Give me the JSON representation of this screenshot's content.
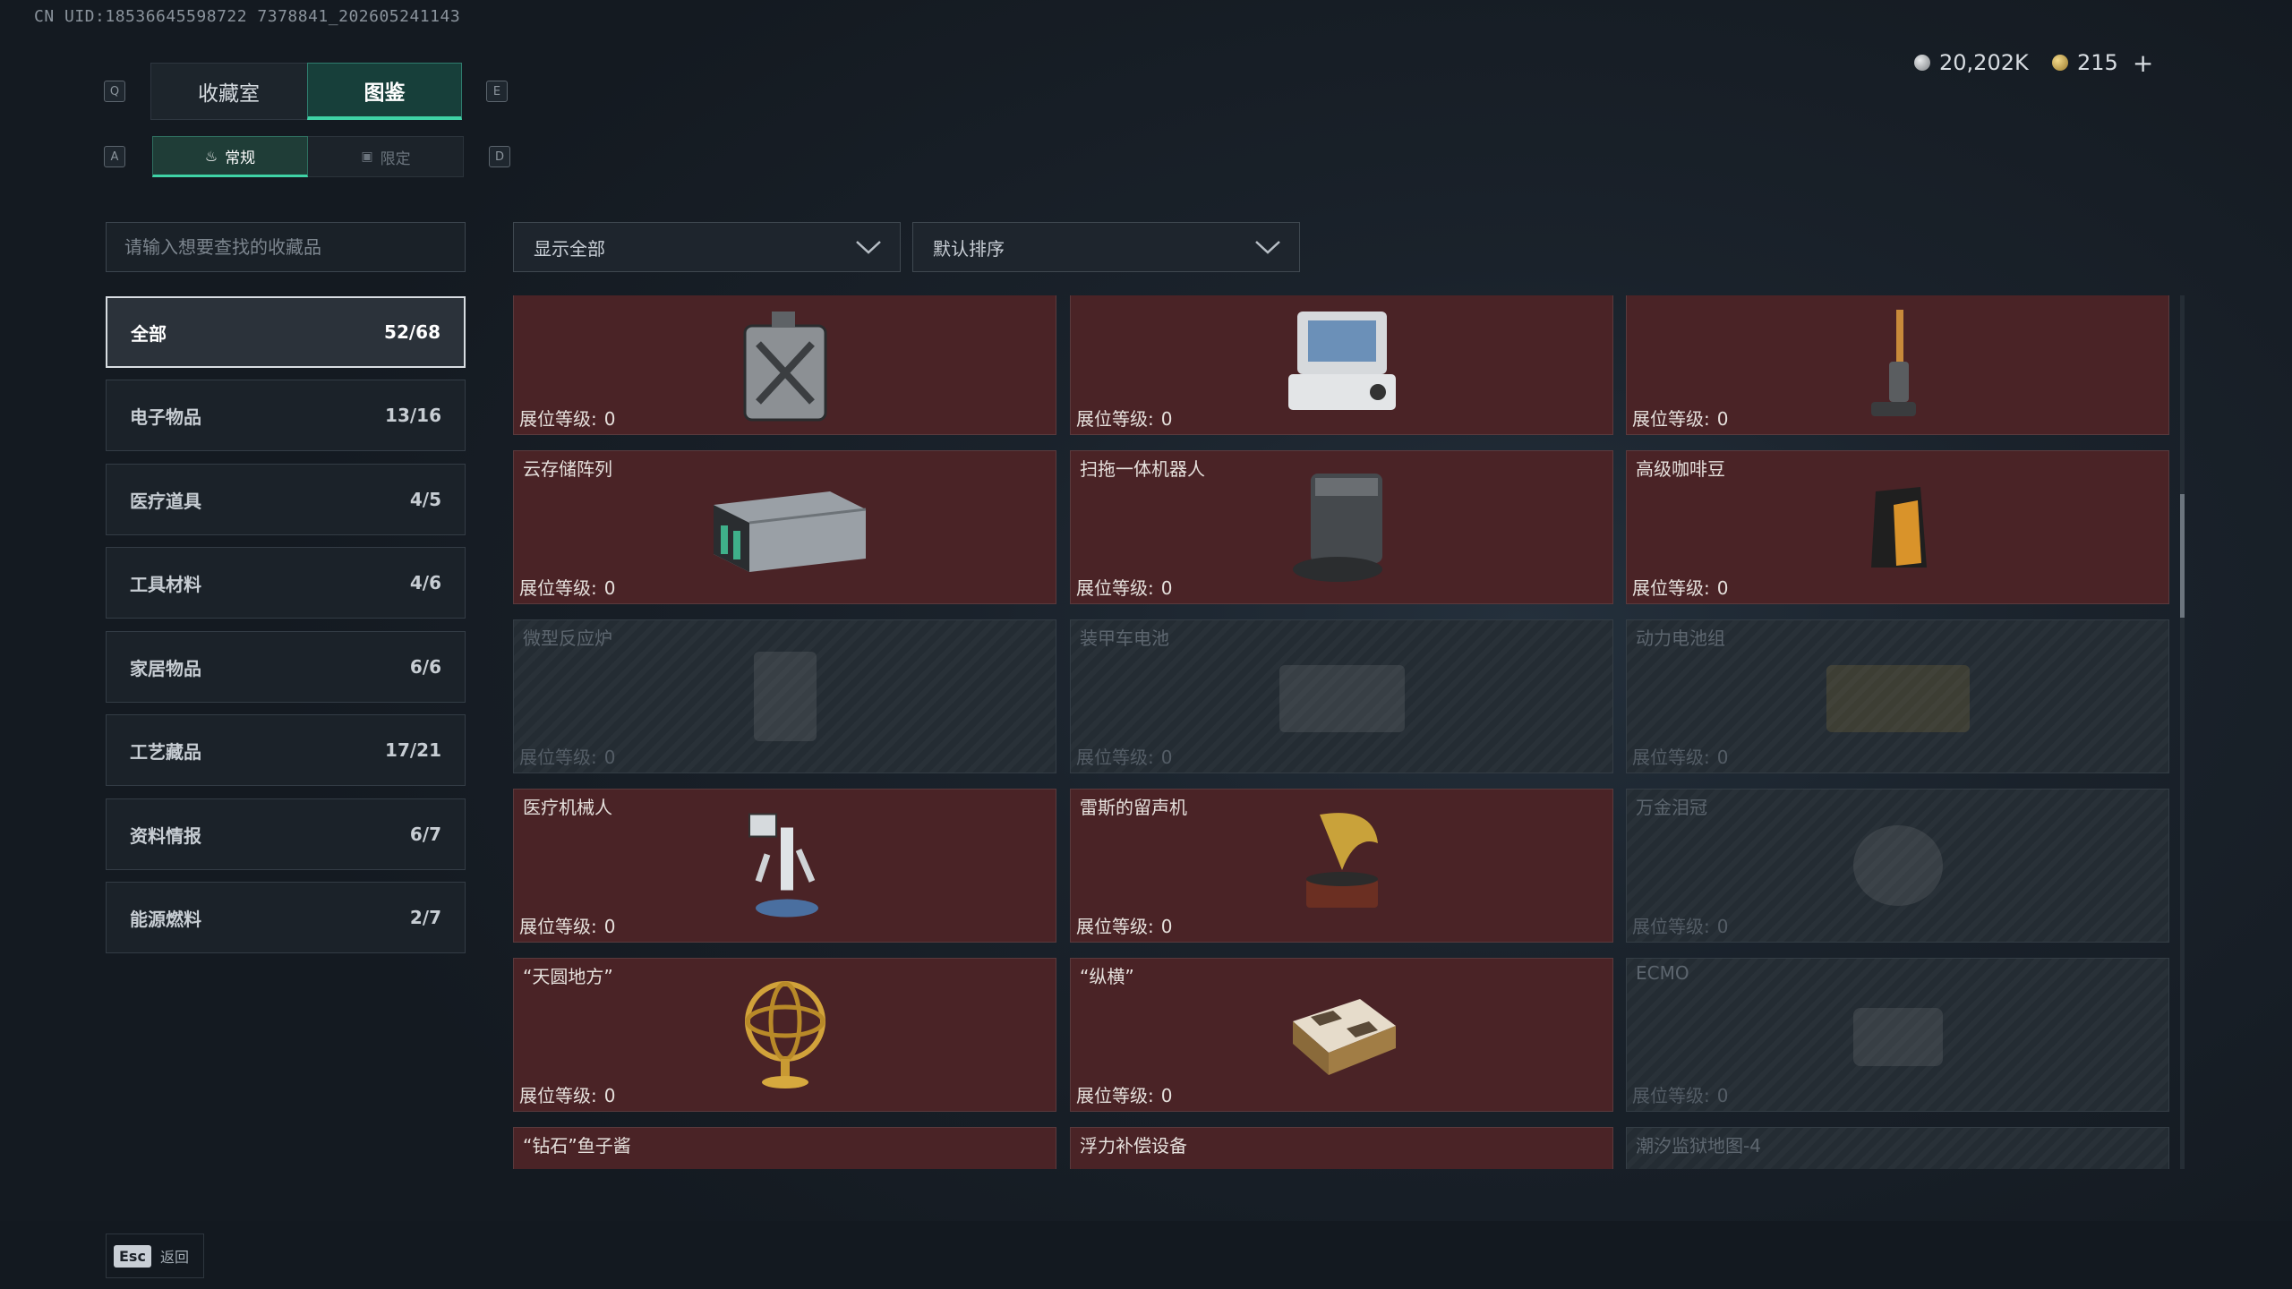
{
  "uid": "CN UID:18536645598722 7378841_202605241143",
  "keys": {
    "prev_tab": "Q",
    "next_tab": "E",
    "prev_sub": "A",
    "next_sub": "D"
  },
  "tabs": [
    {
      "label": "收藏室"
    },
    {
      "label": "图鉴"
    }
  ],
  "subtabs": [
    {
      "label": "常规"
    },
    {
      "label": "限定"
    }
  ],
  "currency": {
    "silver": "20,202K",
    "gold": "215",
    "add": "+"
  },
  "search": {
    "placeholder": "请输入想要查找的收藏品"
  },
  "filters": {
    "show": "显示全部",
    "sort": "默认排序"
  },
  "categories": [
    {
      "label": "全部",
      "count": "52/68"
    },
    {
      "label": "电子物品",
      "count": "13/16"
    },
    {
      "label": "医疗道具",
      "count": "4/5"
    },
    {
      "label": "工具材料",
      "count": "4/6"
    },
    {
      "label": "家居物品",
      "count": "6/6"
    },
    {
      "label": "工艺藏品",
      "count": "17/21"
    },
    {
      "label": "资料情报",
      "count": "6/7"
    },
    {
      "label": "能源燃料",
      "count": "2/7"
    }
  ],
  "level_label": "展位等级:",
  "items": [
    {
      "name": "",
      "level": "0",
      "locked": false,
      "icon": "jerrycan-icon"
    },
    {
      "name": "",
      "level": "0",
      "locked": false,
      "icon": "medical-monitor-icon"
    },
    {
      "name": "",
      "level": "0",
      "locked": false,
      "icon": "floor-washer-icon"
    },
    {
      "name": "云存储阵列",
      "level": "0",
      "locked": false,
      "icon": "storage-array-icon"
    },
    {
      "name": "扫拖一体机器人",
      "level": "0",
      "locked": false,
      "icon": "mop-robot-icon"
    },
    {
      "name": "高级咖啡豆",
      "level": "0",
      "locked": false,
      "icon": "coffee-bag-icon"
    },
    {
      "name": "微型反应炉",
      "level": "0",
      "locked": true,
      "icon": "reactor-icon"
    },
    {
      "name": "装甲车电池",
      "level": "0",
      "locked": true,
      "icon": "battery-icon"
    },
    {
      "name": "动力电池组",
      "level": "0",
      "locked": true,
      "icon": "battery-pack-icon"
    },
    {
      "name": "医疗机械人",
      "level": "0",
      "locked": false,
      "icon": "medical-robot-icon"
    },
    {
      "name": "雷斯的留声机",
      "level": "0",
      "locked": false,
      "icon": "gramophone-icon"
    },
    {
      "name": "万金泪冠",
      "level": "0",
      "locked": true,
      "icon": "crown-icon"
    },
    {
      "name": "“天圆地方”",
      "level": "0",
      "locked": false,
      "icon": "armillary-icon"
    },
    {
      "name": "“纵横”",
      "level": "0",
      "locked": false,
      "icon": "chessboard-icon"
    },
    {
      "name": "ECMO",
      "level": "0",
      "locked": true,
      "icon": "ecmo-icon"
    },
    {
      "name": "“钻石”鱼子酱",
      "level": "",
      "locked": false,
      "icon": "caviar-icon"
    },
    {
      "name": "浮力补偿设备",
      "level": "",
      "locked": false,
      "icon": "bcd-icon"
    },
    {
      "name": "潮汐监狱地图-4",
      "level": "",
      "locked": true,
      "icon": "map-icon"
    }
  ],
  "footer": {
    "key": "Esc",
    "label": "返回"
  }
}
